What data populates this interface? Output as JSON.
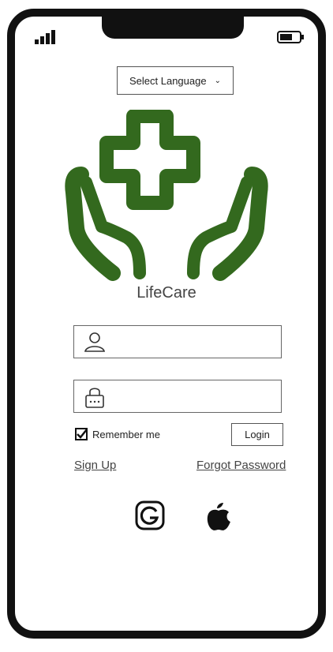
{
  "status_bar": {
    "signal_icon": "signal-bars-icon",
    "battery_icon": "battery-icon"
  },
  "language": {
    "label": "Select Language"
  },
  "brand": {
    "name": "LifeCare",
    "logo_icon": "hands-medical-cross-icon",
    "color": "#33691e"
  },
  "login_form": {
    "username_icon": "user-icon",
    "password_icon": "lock-icon",
    "username_value": "",
    "password_value": "",
    "remember_label": "Remember me",
    "remember_checked": true,
    "login_button": "Login",
    "signup_link": "Sign Up",
    "forgot_link": "Forgot Password"
  },
  "social_login": [
    "google-icon",
    "apple-icon"
  ]
}
